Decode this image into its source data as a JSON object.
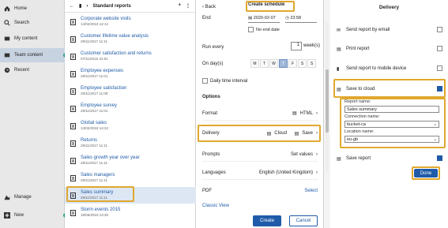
{
  "nav": {
    "home": "Home",
    "search": "Search",
    "my_content": "My content",
    "team_content": "Team content",
    "recent": "Recent",
    "manage": "Manage",
    "new": "New"
  },
  "list": {
    "title": "Standard reports",
    "items": [
      {
        "name": "Corporate website visits",
        "date": "14/02/2019 12:12"
      },
      {
        "name": "Customer lifetime value analysis",
        "date": "29/11/2017 11:11"
      },
      {
        "name": "Customer satisfaction and returns",
        "date": "07/11/2019 22:51"
      },
      {
        "name": "Employee expenses",
        "date": "29/11/2017 11:01"
      },
      {
        "name": "Employee satisfaction",
        "date": "29/11/2017 11:08"
      },
      {
        "name": "Employee survey",
        "date": "29/11/2017 11:01"
      },
      {
        "name": "Global sales",
        "date": "13/02/2018 14:22"
      },
      {
        "name": "Returns",
        "date": "29/11/2017 11:11"
      },
      {
        "name": "Sales growth year over year",
        "date": "29/11/2017 11:11"
      },
      {
        "name": "Sales managers",
        "date": "29/11/2017 11:11"
      },
      {
        "name": "Sales summary",
        "date": "29/11/2017 11:11"
      },
      {
        "name": "Storm events 2015",
        "date": "18/06/2019 13:30"
      }
    ]
  },
  "schedule": {
    "back": "Back",
    "title": "Create schedule",
    "end_label": "End",
    "end_date": "2020-02-07",
    "end_time": "23:58",
    "no_end_date": "No end date",
    "run_every": "Run every",
    "run_every_value": "1",
    "run_every_unit": "week(s)",
    "on_days": "On day(s)",
    "days": [
      "M",
      "T",
      "W",
      "T",
      "F",
      "S",
      "S"
    ],
    "daily_interval": "Daily time interval",
    "options": "Options",
    "format": "Format",
    "format_value": "HTML",
    "delivery": "Delivery",
    "delivery_cloud": "Cloud",
    "delivery_save": "Save",
    "prompts": "Prompts",
    "prompts_value": "Set values",
    "languages": "Languages",
    "languages_value": "English (United Kingdom)",
    "pdf": "PDF",
    "pdf_value": "Select",
    "classic_view": "Classic View",
    "create": "Create",
    "cancel": "Cancel"
  },
  "delivery": {
    "title": "Delivery",
    "send_email": "Send report by email",
    "print_report": "Print report",
    "send_mobile": "Send report to mobile device",
    "save_cloud": "Save to cloud",
    "report_name_label": "Report name:",
    "report_name": "Sales summary",
    "connection_label": "Connection name:",
    "connection": "bucket-ca",
    "location_label": "Location name:",
    "location": "eu-gb",
    "save_report": "Save report",
    "done": "Done"
  },
  "colors": {
    "accent": "#1f5ba8",
    "highlight": "#e0a82e",
    "active_dot": "#2aa37f"
  }
}
